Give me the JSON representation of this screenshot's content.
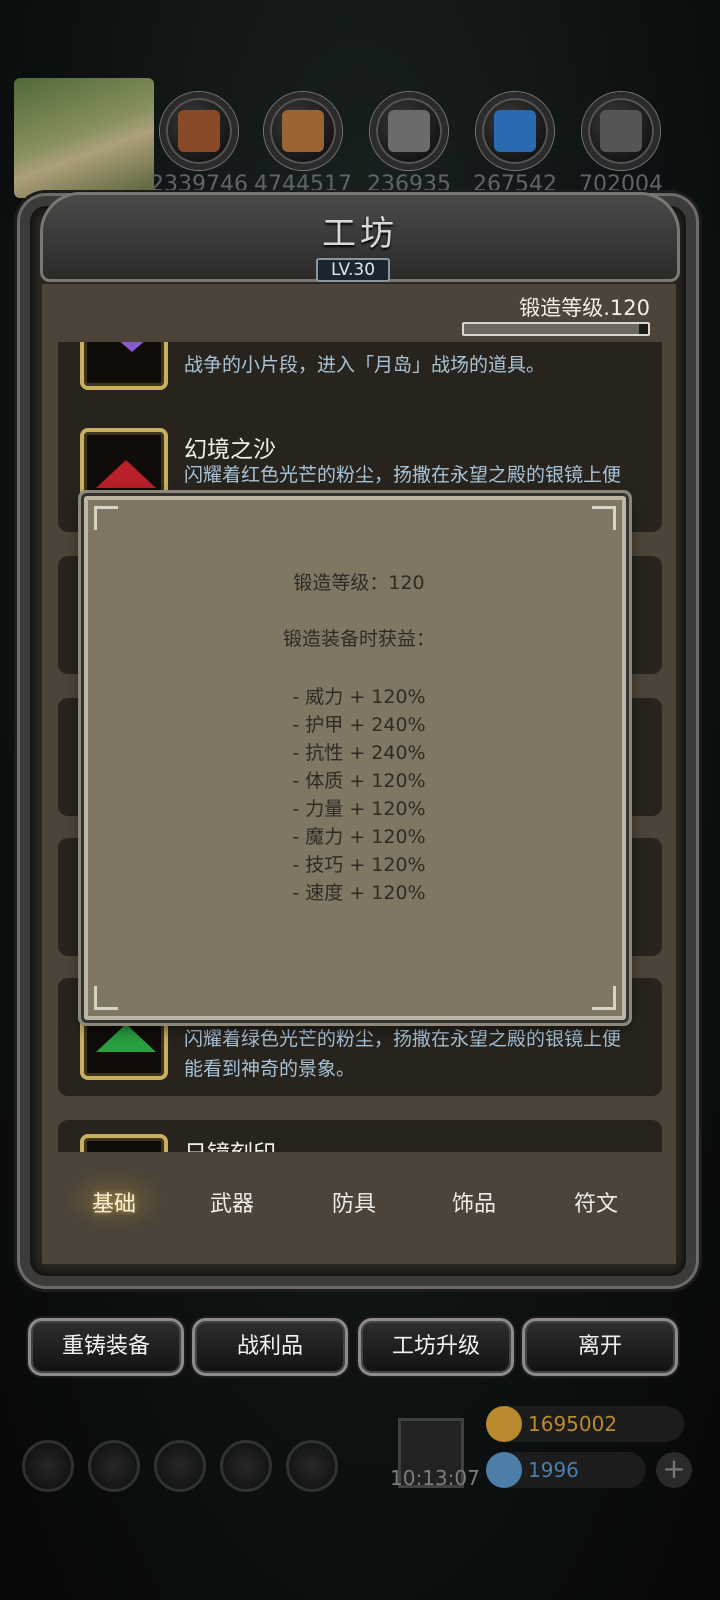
{
  "resources": {
    "items": [
      {
        "name": "ore-icon",
        "count": "2339746",
        "color": "#8a4a2a"
      },
      {
        "name": "wood-icon",
        "count": "4744517",
        "color": "#9a6434"
      },
      {
        "name": "iron-icon",
        "count": "236935",
        "color": "#6b6b6b"
      },
      {
        "name": "crystal-icon",
        "count": "267542",
        "color": "#2a6ab0"
      },
      {
        "name": "metal-icon",
        "count": "702004",
        "color": "#555555"
      }
    ]
  },
  "header": {
    "title": "工坊",
    "level": "LV.30"
  },
  "forge": {
    "level_label": "锻造等级.120",
    "progress": 0.95
  },
  "items": [
    {
      "name": "",
      "desc": "战争的小片段，进入「月岛」战场的道具。",
      "gem_color": "#8a5ad0"
    },
    {
      "name": "幻境之沙",
      "desc": "闪耀着红色光芒的粉尘，扬撒在永望之殿的银镜上便能看到神奇的景象。",
      "gem_color": "#b8202a"
    },
    {
      "name": "",
      "desc": "闪耀着绿色光芒的粉尘，扬撒在永望之殿的银镜上便能看到神奇的景象。",
      "gem_color": "#2aa040"
    },
    {
      "name": "日镜刻印",
      "desc": ""
    }
  ],
  "tabs": [
    "基础",
    "武器",
    "防具",
    "饰品",
    "符文"
  ],
  "tooltip": {
    "level_line": "锻造等级：120",
    "gain_title": "锻造装备时获益：",
    "stats": [
      "- 威力 + 120%",
      "- 护甲 + 240%",
      "- 抗性 + 240%",
      "- 体质 + 120%",
      "- 力量 + 120%",
      "- 魔力 + 120%",
      "- 技巧 + 120%",
      "- 速度 + 120%"
    ]
  },
  "buttons": {
    "reforge": "重铸装备",
    "loot": "战利品",
    "upgrade": "工坊升级",
    "leave": "离开"
  },
  "hud": {
    "time": "10:13:07",
    "gold": "1695002",
    "gems": "1996",
    "gold_color": "#b98a30",
    "gem_color": "#4d7ea8"
  }
}
